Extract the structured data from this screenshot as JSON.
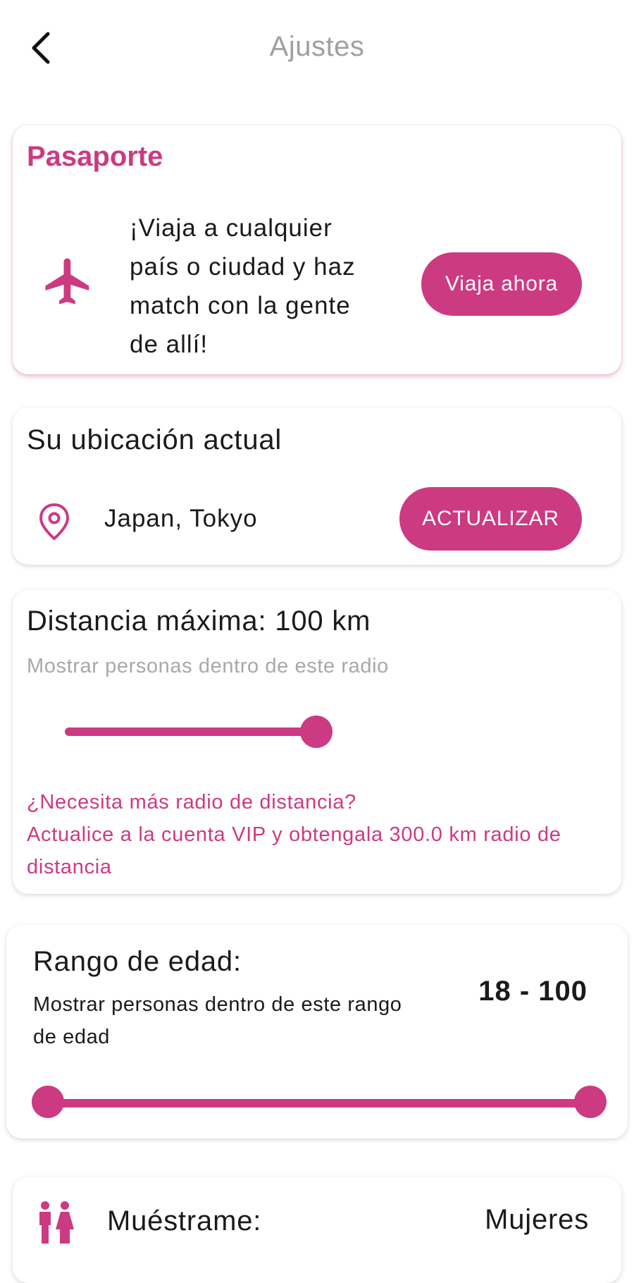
{
  "header": {
    "title": "Ajustes",
    "back_icon": "chevron-left-icon"
  },
  "passport": {
    "title": "Pasaporte",
    "icon": "airplane-icon",
    "description": "¡Viaja a cualquier país o ciudad y haz match con la gente de allí!",
    "button_label": "Viaja ahora"
  },
  "location": {
    "title": "Su ubicación actual",
    "icon": "location-pin-icon",
    "value": "Japan, Tokyo",
    "button_label": "ACTUALIZAR"
  },
  "distance": {
    "title": "Distancia máxima: 100 km",
    "subtitle": "Mostrar personas dentro de este radio",
    "slider_value": 100,
    "slider_max": 300,
    "vip_note": "¿Necesita más radio de distancia?\nActualice a la cuenta VIP y obtengala 300.0 km radio de distancia"
  },
  "age": {
    "title": "Rango de edad:",
    "subtitle": "Mostrar personas dentro de este rango de edad",
    "range_label": "18 - 100",
    "min": 18,
    "max": 100
  },
  "show_me": {
    "icon": "people-icon",
    "label": "Muéstrame:",
    "value": "Mujeres"
  },
  "colors": {
    "accent": "#cc3a82",
    "title_gray": "#a0a0a0",
    "subtitle_gray": "#a8a8a8",
    "text": "#1a1a1a"
  }
}
